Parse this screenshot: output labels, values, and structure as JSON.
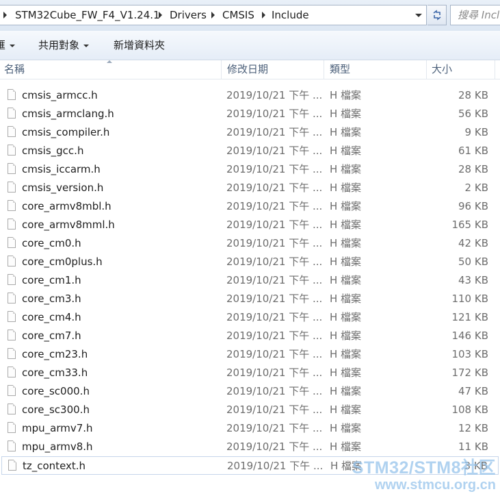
{
  "address_bar": {
    "crumbs": [
      "STM32Cube_FW_F4_V1.24.1",
      "Drivers",
      "CMSIS",
      "Include"
    ],
    "search_placeholder": "搜尋 Inclu"
  },
  "toolbar": {
    "organize_label": "匯",
    "share_label": "共用對象",
    "new_folder_label": "新增資料夾"
  },
  "columns": {
    "name": "名稱",
    "modified": "修改日期",
    "type": "類型",
    "size": "大小"
  },
  "files": [
    {
      "name": "cmsis_armcc.h",
      "modified": "2019/10/21 下午 ...",
      "type": "H 檔案",
      "size": "28 KB"
    },
    {
      "name": "cmsis_armclang.h",
      "modified": "2019/10/21 下午 ...",
      "type": "H 檔案",
      "size": "56 KB"
    },
    {
      "name": "cmsis_compiler.h",
      "modified": "2019/10/21 下午 ...",
      "type": "H 檔案",
      "size": "9 KB"
    },
    {
      "name": "cmsis_gcc.h",
      "modified": "2019/10/21 下午 ...",
      "type": "H 檔案",
      "size": "61 KB"
    },
    {
      "name": "cmsis_iccarm.h",
      "modified": "2019/10/21 下午 ...",
      "type": "H 檔案",
      "size": "28 KB"
    },
    {
      "name": "cmsis_version.h",
      "modified": "2019/10/21 下午 ...",
      "type": "H 檔案",
      "size": "2 KB"
    },
    {
      "name": "core_armv8mbl.h",
      "modified": "2019/10/21 下午 ...",
      "type": "H 檔案",
      "size": "96 KB"
    },
    {
      "name": "core_armv8mml.h",
      "modified": "2019/10/21 下午 ...",
      "type": "H 檔案",
      "size": "165 KB"
    },
    {
      "name": "core_cm0.h",
      "modified": "2019/10/21 下午 ...",
      "type": "H 檔案",
      "size": "42 KB"
    },
    {
      "name": "core_cm0plus.h",
      "modified": "2019/10/21 下午 ...",
      "type": "H 檔案",
      "size": "50 KB"
    },
    {
      "name": "core_cm1.h",
      "modified": "2019/10/21 下午 ...",
      "type": "H 檔案",
      "size": "43 KB"
    },
    {
      "name": "core_cm3.h",
      "modified": "2019/10/21 下午 ...",
      "type": "H 檔案",
      "size": "110 KB"
    },
    {
      "name": "core_cm4.h",
      "modified": "2019/10/21 下午 ...",
      "type": "H 檔案",
      "size": "121 KB"
    },
    {
      "name": "core_cm7.h",
      "modified": "2019/10/21 下午 ...",
      "type": "H 檔案",
      "size": "146 KB"
    },
    {
      "name": "core_cm23.h",
      "modified": "2019/10/21 下午 ...",
      "type": "H 檔案",
      "size": "103 KB"
    },
    {
      "name": "core_cm33.h",
      "modified": "2019/10/21 下午 ...",
      "type": "H 檔案",
      "size": "172 KB"
    },
    {
      "name": "core_sc000.h",
      "modified": "2019/10/21 下午 ...",
      "type": "H 檔案",
      "size": "47 KB"
    },
    {
      "name": "core_sc300.h",
      "modified": "2019/10/21 下午 ...",
      "type": "H 檔案",
      "size": "108 KB"
    },
    {
      "name": "mpu_armv7.h",
      "modified": "2019/10/21 下午 ...",
      "type": "H 檔案",
      "size": "12 KB"
    },
    {
      "name": "mpu_armv8.h",
      "modified": "2019/10/21 下午 ...",
      "type": "H 檔案",
      "size": "11 KB"
    },
    {
      "name": "tz_context.h",
      "modified": "2019/10/21 下午 ...",
      "type": "H 檔案",
      "size": "3 KB",
      "selected": true
    }
  ],
  "watermark": {
    "line1": "STM32/STM8社区",
    "line2": "www.stmcu.org.cn"
  }
}
